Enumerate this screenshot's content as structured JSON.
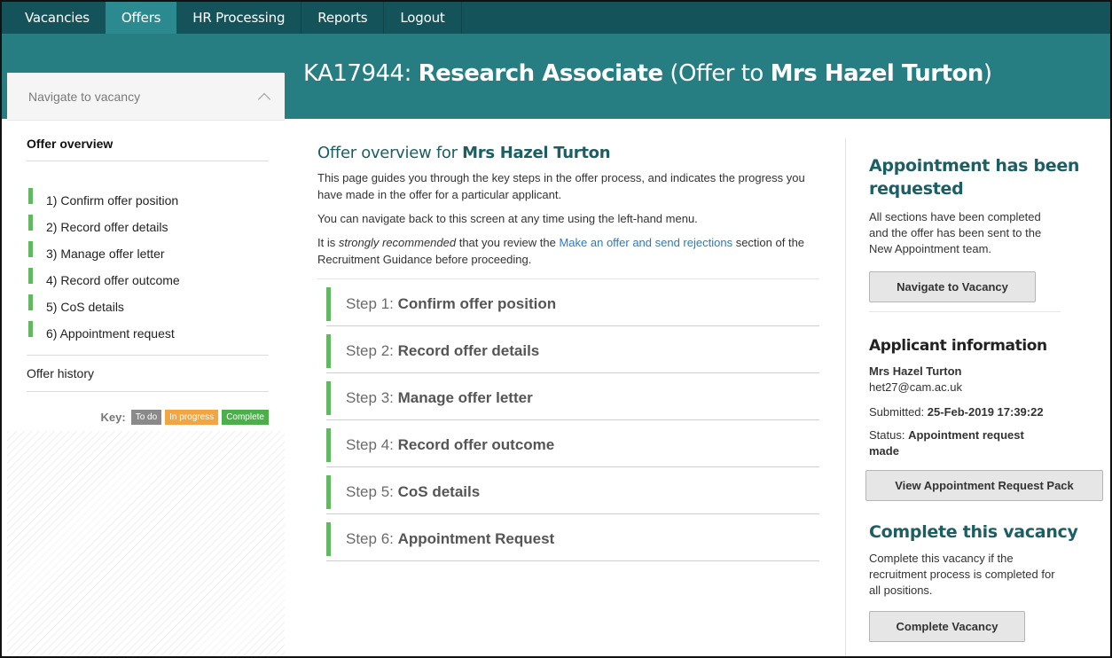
{
  "nav": {
    "items": [
      {
        "label": "Vacancies"
      },
      {
        "label": "Offers"
      },
      {
        "label": "HR Processing"
      },
      {
        "label": "Reports"
      },
      {
        "label": "Logout"
      }
    ],
    "active_index": 1
  },
  "header": {
    "ref": "KA17944:",
    "role": "Research Associate",
    "offer_prefix": "(Offer to",
    "applicant": "Mrs Hazel Turton",
    "offer_suffix": ")"
  },
  "sidebar": {
    "navigate_label": "Navigate to vacancy",
    "overview_label": "Offer overview",
    "items": [
      {
        "label": "1) Confirm offer position",
        "status": "complete"
      },
      {
        "label": "2) Record offer details",
        "status": "complete"
      },
      {
        "label": "3) Manage offer letter",
        "status": "complete"
      },
      {
        "label": "4) Record offer outcome",
        "status": "complete"
      },
      {
        "label": "5) CoS details",
        "status": "complete"
      },
      {
        "label": "6) Appointment request",
        "status": "complete"
      }
    ],
    "history_label": "Offer history",
    "key": {
      "label": "Key:",
      "todo": "To do",
      "in_progress": "In progress",
      "complete": "Complete"
    }
  },
  "main": {
    "heading_prefix": "Offer overview for",
    "heading_name": "Mrs Hazel Turton",
    "intro": "This page guides you through the key steps in the offer process, and indicates the progress you have made in the offer for a particular applicant.",
    "nav_note": "You can navigate back to this screen at any time using the left-hand menu.",
    "rec_prefix": "It is",
    "rec_em": "strongly recommended",
    "rec_mid": "that you review the",
    "rec_link": "Make an offer and send rejections",
    "rec_suffix": "section of the Recruitment Guidance before proceeding.",
    "steps": [
      {
        "prefix": "Step 1:",
        "title": "Confirm offer position"
      },
      {
        "prefix": "Step 2:",
        "title": "Record offer details"
      },
      {
        "prefix": "Step 3:",
        "title": "Manage offer letter"
      },
      {
        "prefix": "Step 4:",
        "title": "Record offer outcome"
      },
      {
        "prefix": "Step 5:",
        "title": "CoS details"
      },
      {
        "prefix": "Step 6:",
        "title": "Appointment Request"
      }
    ]
  },
  "right": {
    "appt_heading": "Appointment has been requested",
    "appt_text": "All sections have been completed and the offer has been sent to the New Appointment team.",
    "navigate_button": "Navigate to Vacancy",
    "applicant_heading": "Applicant information",
    "applicant_name": "Mrs Hazel Turton",
    "applicant_email": "het27@cam.ac.uk",
    "submitted_label": "Submitted:",
    "submitted_value": "25-Feb-2019 17:39:22",
    "status_label": "Status:",
    "status_value": "Appointment request made",
    "view_pack_button": "View Appointment Request Pack",
    "complete_heading": "Complete this vacancy",
    "complete_text": "Complete this vacancy if the recruitment process is completed for all positions.",
    "complete_button": "Complete Vacancy"
  },
  "colors": {
    "nav_bg": "#15535a",
    "banner_bg": "#267d82",
    "active_tab": "#2a8a8f",
    "complete_green": "#62b860",
    "in_progress_orange": "#f2a541",
    "todo_grey": "#8a8a8a",
    "heading_teal": "#1d5e63",
    "link_blue": "#2e78c2"
  }
}
